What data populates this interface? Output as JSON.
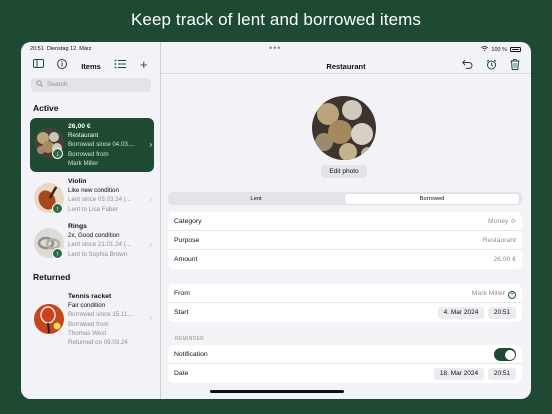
{
  "headline": "Keep track of lent and borrowed items",
  "status_bar": {
    "time": "20:51",
    "date": "Dienstag 12. März",
    "battery": "100 %"
  },
  "sidebar": {
    "title": "Items",
    "search_placeholder": "Search",
    "active_header": "Active",
    "returned_header": "Returned",
    "active_items": [
      {
        "name": "26,00 €",
        "line1": "Restaurant",
        "line2": "Borrowed since 04.03....",
        "line3": "Borrowed from",
        "line4": "Mark Miller",
        "badge": "↓",
        "selected": true
      },
      {
        "name": "Violin",
        "line1": "Like new condition",
        "line2": "Lent since 03.03.24 (...",
        "line3": "Lent to Lisa Faber",
        "badge": "↑"
      },
      {
        "name": "Rings",
        "line1": "2x, Good condition",
        "line2": "Lent since 21.01.24 (...",
        "line3": "Lent to Sophia Brown",
        "badge": "↑"
      }
    ],
    "returned_items": [
      {
        "name": "Tennis racket",
        "line1": "Fair condition",
        "line2": "Borrowed since 15.11....",
        "line3": "Borrowed from",
        "line4": "Thomas West",
        "line5": "Returned on 09.03.24"
      }
    ]
  },
  "detail": {
    "title": "Restaurant",
    "edit_photo": "Edit photo",
    "segments": [
      "Lent",
      "Borrowed"
    ],
    "selected_segment": "Borrowed",
    "fields": {
      "category_label": "Category",
      "category_value": "Money ≎",
      "purpose_label": "Purpose",
      "purpose_value": "Restaurant",
      "amount_label": "Amount",
      "amount_value": "26,00 €",
      "from_label": "From",
      "from_value": "Mark Miller",
      "start_label": "Start",
      "start_date": "4. Mar 2024",
      "start_time": "20:51",
      "reminder_header": "REMINDER",
      "notification_label": "Notification",
      "notification_on": true,
      "date_label": "Date",
      "reminder_date": "18. Mar 2024",
      "reminder_time": "20:51"
    }
  },
  "colors": {
    "accent": "#1e4a33",
    "background": "#1e4a33"
  }
}
